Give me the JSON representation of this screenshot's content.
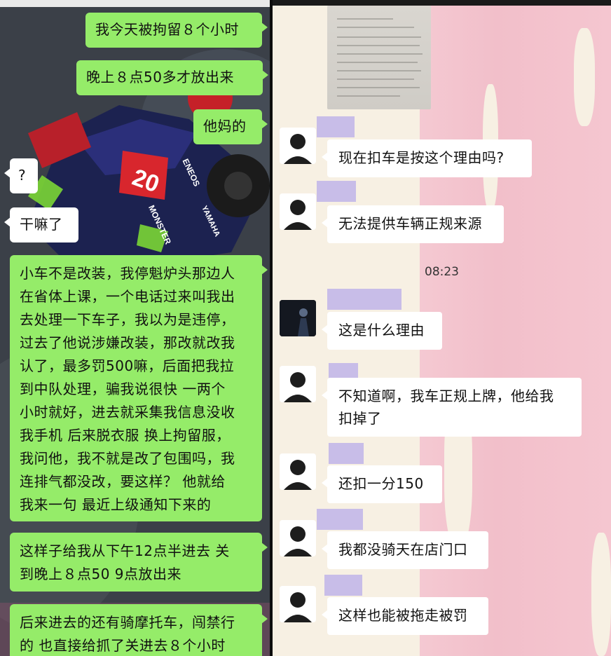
{
  "left_chat": {
    "messages": [
      {
        "side": "right",
        "text": "我今天被拘留８个小时"
      },
      {
        "side": "right",
        "text": "晚上８点50多才放出来"
      },
      {
        "side": "right",
        "text": "他妈的"
      },
      {
        "side": "left",
        "text": "?"
      },
      {
        "side": "left",
        "text": "干嘛了"
      },
      {
        "side": "right",
        "text": "小车不是改装，我停魁炉头那边人\n在省体上课，一个电话过来叫我出\n去处理一下车子，我以为是违停，\n过去了他说涉嫌改装，那改就改我\n认了，最多罚500嘛，后面把我拉\n到中队处理，骗我说很快 一两个\n小时就好，进去就采集我信息没收\n我手机 后来脱衣服 换上拘留服，\n我问他，我不就是改了包围吗，我\n连排气都没改，要这样？ 他就给\n我来一句 最近上级通知下来的"
      },
      {
        "side": "right",
        "text": "这样子给我从下午12点半进去 关\n到晚上８点50 9点放出来"
      },
      {
        "side": "right",
        "text": "后来进去的还有骑摩托车，闯禁行\n的 也直接给抓了关进去８个小时"
      }
    ],
    "background_image": "motorcycle-racer-photo",
    "bike_number": "20",
    "bike_brands": [
      "MONSTER",
      "ENEOS",
      "YAMAHA"
    ]
  },
  "right_chat": {
    "timestamp": "08:23",
    "messages": [
      {
        "text": "现在扣车是按这个理由吗?"
      },
      {
        "text": "无法提供车辆正规来源"
      },
      {
        "text": "这是什么理由"
      },
      {
        "text": "不知道啊，我车正规上牌，他给我\n扣掉了"
      },
      {
        "text": "还扣一分150"
      },
      {
        "text": "我都没骑天在店门口"
      },
      {
        "text": "这样也能被拖走被罚"
      }
    ],
    "colors": {
      "name_redaction": "#c8bde8",
      "pink_wall": "#f4c9d2",
      "cream_wall": "#f7f0e3"
    }
  },
  "colors": {
    "green_bubble": "#95ec69",
    "white_bubble": "#ffffff"
  }
}
